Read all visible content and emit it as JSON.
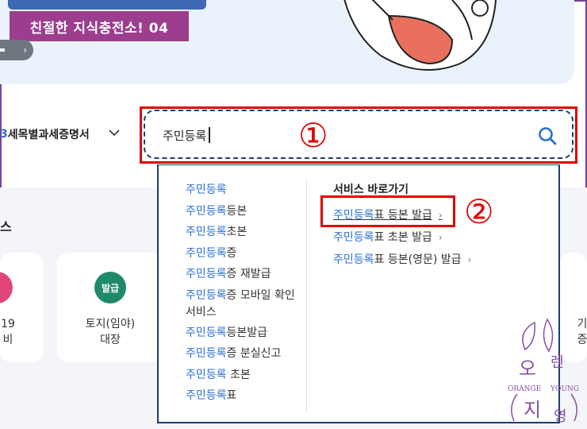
{
  "banner": {
    "badge_text": "친절한 지식충전소! 04",
    "pager_text": "›"
  },
  "category_select": {
    "prefix_number": "3",
    "label": "세목별과세증명서"
  },
  "search": {
    "value": "주민등록",
    "annotation_marker": "①"
  },
  "dropdown": {
    "suggestions": [
      {
        "highlight": "주민등록",
        "rest": ""
      },
      {
        "highlight": "주민등록",
        "rest": "등본"
      },
      {
        "highlight": "주민등록",
        "rest": "초본"
      },
      {
        "highlight": "주민등록",
        "rest": "증"
      },
      {
        "highlight": "주민등록",
        "rest": "증 재발급"
      },
      {
        "highlight": "주민등록",
        "rest": "증 모바일 확인 서비스"
      },
      {
        "highlight": "주민등록",
        "rest": "등본발급"
      },
      {
        "highlight": "주민등록",
        "rest": "증 분실신고"
      },
      {
        "highlight": "주민등록",
        "rest": " 초본"
      },
      {
        "highlight": "주민등록",
        "rest": "표"
      }
    ],
    "shortcut_title": "서비스 바로가기",
    "shortcuts": [
      {
        "highlight": "주민등록",
        "rest": "표 등본 발급",
        "arrow": "›"
      },
      {
        "highlight": "주민등록",
        "rest": "표 초본 발급",
        "arrow": "›"
      },
      {
        "highlight": "주민등록",
        "rest": "표 등본(영문) 발급",
        "arrow": "›"
      }
    ],
    "annotation_marker": "②"
  },
  "background_section": {
    "title": "스",
    "cards": [
      {
        "icon_label": "",
        "lines": [
          "19",
          "비"
        ]
      },
      {
        "icon_label": "발급",
        "lines": [
          "토지(임야)",
          "대장"
        ]
      },
      {
        "icon_label": "",
        "lines": [
          "기",
          "증"
        ]
      }
    ]
  },
  "watermark": {
    "top_char_1": "오",
    "top_char_2": "렌",
    "left_word": "ORANGE",
    "right_word": "YOUNG",
    "bottom_char_1": "지",
    "bottom_char_2": "영"
  },
  "colors": {
    "accent_blue": "#2a6fd6",
    "annotation_red": "#e00000",
    "badge_purple": "#9c3d8e",
    "icon_green": "#1f8a6a",
    "icon_pink": "#e0457b",
    "watermark_purple": "#8a4fa6"
  }
}
